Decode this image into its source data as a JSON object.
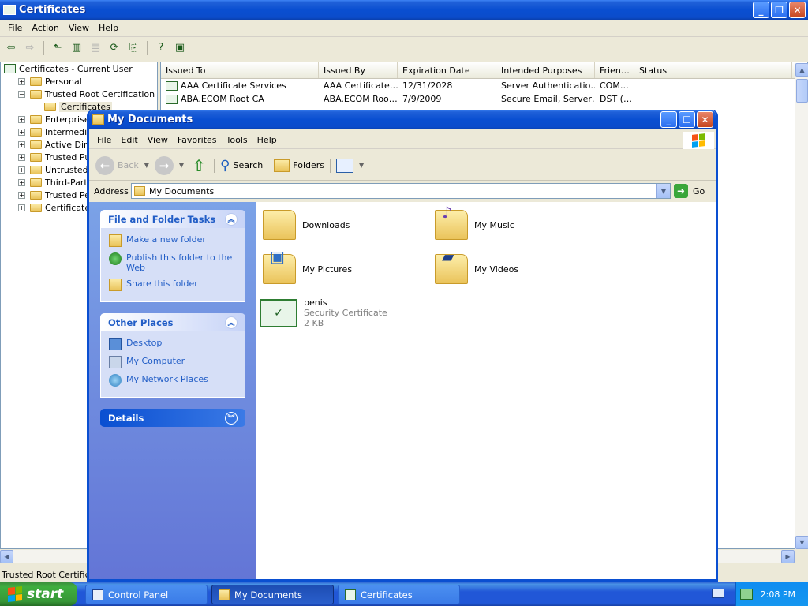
{
  "cert_window": {
    "title": "Certificates",
    "menu": [
      "File",
      "Action",
      "View",
      "Help"
    ],
    "tree": [
      {
        "label": "Certificates - Current User",
        "indent": 0,
        "expander": "",
        "icon": "cert"
      },
      {
        "label": "Personal",
        "indent": 1,
        "expander": "+",
        "icon": "folder"
      },
      {
        "label": "Trusted Root Certification Autho",
        "indent": 1,
        "expander": "-",
        "icon": "folder"
      },
      {
        "label": "Certificates",
        "indent": 2,
        "expander": "",
        "icon": "folder",
        "selected": true
      },
      {
        "label": "Enterprise Tru",
        "indent": 1,
        "expander": "+",
        "icon": "folder"
      },
      {
        "label": "Intermediate",
        "indent": 1,
        "expander": "+",
        "icon": "folder"
      },
      {
        "label": "Active Directo",
        "indent": 1,
        "expander": "+",
        "icon": "folder"
      },
      {
        "label": "Trusted Publis",
        "indent": 1,
        "expander": "+",
        "icon": "folder"
      },
      {
        "label": "Untrusted Cer",
        "indent": 1,
        "expander": "+",
        "icon": "folder"
      },
      {
        "label": "Third-Party Ro",
        "indent": 1,
        "expander": "+",
        "icon": "folder"
      },
      {
        "label": "Trusted Peopl",
        "indent": 1,
        "expander": "+",
        "icon": "folder"
      },
      {
        "label": "Certificate En",
        "indent": 1,
        "expander": "+",
        "icon": "folder"
      }
    ],
    "columns": [
      "Issued To",
      "Issued By",
      "Expiration Date",
      "Intended Purposes",
      "Frien…",
      "Status"
    ],
    "rows": [
      [
        "AAA Certificate Services",
        "AAA Certificate…",
        "12/31/2028",
        "Server Authenticatio…",
        "COM…",
        ""
      ],
      [
        "ABA.ECOM Root CA",
        "ABA.ECOM Roo…",
        "7/9/2009",
        "Secure Email, Server…",
        "DST (…",
        ""
      ]
    ],
    "status_text": "Trusted Root Certificat"
  },
  "doc_window": {
    "title": "My Documents",
    "menu": [
      "File",
      "Edit",
      "View",
      "Favorites",
      "Tools",
      "Help"
    ],
    "toolbar": {
      "back": "Back",
      "search": "Search",
      "folders": "Folders"
    },
    "address_label": "Address",
    "address_value": "My Documents",
    "go_label": "Go",
    "tasks": {
      "file_folder": {
        "title": "File and Folder Tasks",
        "items": [
          "Make a new folder",
          "Publish this folder to the Web",
          "Share this folder"
        ]
      },
      "other_places": {
        "title": "Other Places",
        "items": [
          "Desktop",
          "My Computer",
          "My Network Places"
        ]
      },
      "details": {
        "title": "Details"
      }
    },
    "items": [
      {
        "name": "Downloads"
      },
      {
        "name": "My Music"
      },
      {
        "name": "My Pictures"
      },
      {
        "name": "My Videos"
      },
      {
        "name": "penis",
        "type": "Security Certificate",
        "size": "2 KB"
      }
    ]
  },
  "taskbar": {
    "start": "start",
    "buttons": [
      "Control Panel",
      "My Documents",
      "Certificates"
    ],
    "active_button": "My Documents",
    "clock": "2:08 PM"
  },
  "colors": {
    "xp_blue": "#0a4fd1",
    "start_green": "#3fae3f",
    "task_link": "#215dc6"
  }
}
